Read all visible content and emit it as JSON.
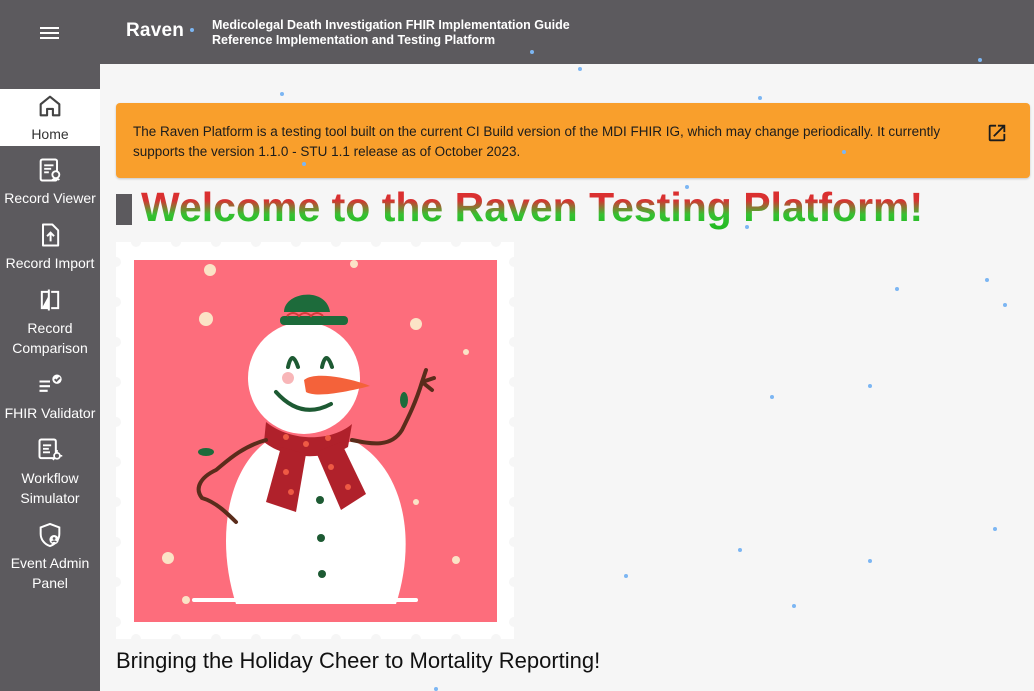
{
  "header": {
    "brand": "Raven",
    "subtitle_line1": "Medicolegal Death Investigation FHIR Implementation Guide",
    "subtitle_line2": "Reference Implementation and Testing Platform"
  },
  "sidebar": {
    "items": [
      {
        "label": "Home",
        "icon": "home-icon",
        "active": true
      },
      {
        "label": "Record Viewer",
        "icon": "record-viewer-icon"
      },
      {
        "label": "Record Import",
        "icon": "upload-file-icon"
      },
      {
        "label": "Record Comparison",
        "icon": "compare-icon"
      },
      {
        "label": "FHIR Validator",
        "icon": "checklist-icon"
      },
      {
        "label": "Workflow Simulator",
        "icon": "workflow-icon"
      },
      {
        "label": "Event Admin Panel",
        "icon": "admin-shield-icon"
      }
    ]
  },
  "banner": {
    "text": "The Raven Platform is a testing tool built on the current CI Build version of the MDI FHIR IG, which may change periodically. It currently supports the version 1.1.0 - STU 1.1 release as of October 2023.",
    "link_icon": "open-in-new-icon",
    "color": "#f99f2c"
  },
  "main": {
    "welcome": "Welcome to the Raven Testing Platform!",
    "tagline": "Bringing the Holiday Cheer to Mortality Reporting!",
    "illustration": "snowman-stamp"
  }
}
